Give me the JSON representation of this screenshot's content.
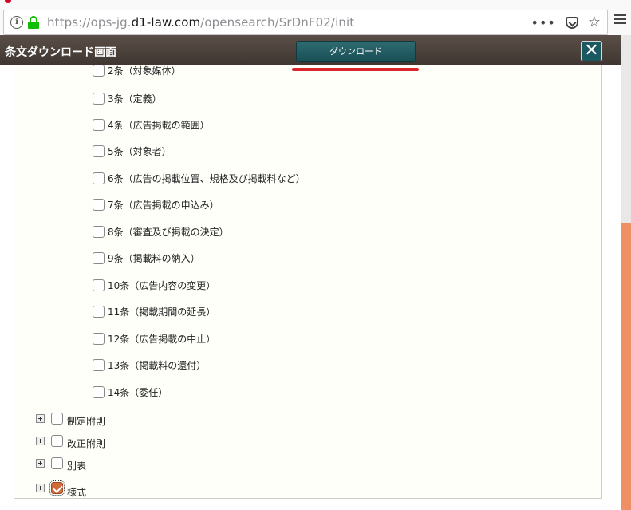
{
  "browser": {
    "url_prefix": "https://ops-jg.",
    "url_host": "d1-law.com",
    "url_path": "/opensearch/SrDnF02/init",
    "info_glyph": "i",
    "dots_glyph": "•••",
    "star_glyph": "☆"
  },
  "modal": {
    "title": "条文ダウンロード画面",
    "download_label": "ダウンロード",
    "close_glyph": "✕"
  },
  "articles": [
    {
      "label": "2条（対象媒体）",
      "checked": false
    },
    {
      "label": "3条（定義）",
      "checked": false
    },
    {
      "label": "4条（広告掲載の範囲）",
      "checked": false
    },
    {
      "label": "5条（対象者）",
      "checked": false
    },
    {
      "label": "6条（広告の掲載位置、規格及び掲載料など）",
      "checked": false
    },
    {
      "label": "7条（広告掲載の申込み）",
      "checked": false
    },
    {
      "label": "8条（審査及び掲載の決定）",
      "checked": false
    },
    {
      "label": "9条（掲載料の納入）",
      "checked": false
    },
    {
      "label": "10条（広告内容の変更）",
      "checked": false
    },
    {
      "label": "11条（掲載期間の延長）",
      "checked": false
    },
    {
      "label": "12条（広告掲載の中止）",
      "checked": false
    },
    {
      "label": "13条（掲載料の還付）",
      "checked": false
    },
    {
      "label": "14条（委任）",
      "checked": false
    }
  ],
  "groups": [
    {
      "label": "制定附則",
      "checked": false
    },
    {
      "label": "改正附則",
      "checked": false
    },
    {
      "label": "別表",
      "checked": false
    },
    {
      "label": "様式",
      "checked": true
    }
  ],
  "colors": {
    "accent": "#1b5960",
    "checked": "#d16a3b",
    "scroll_thumb": "#ef8f64",
    "underline": "#d9262c"
  }
}
